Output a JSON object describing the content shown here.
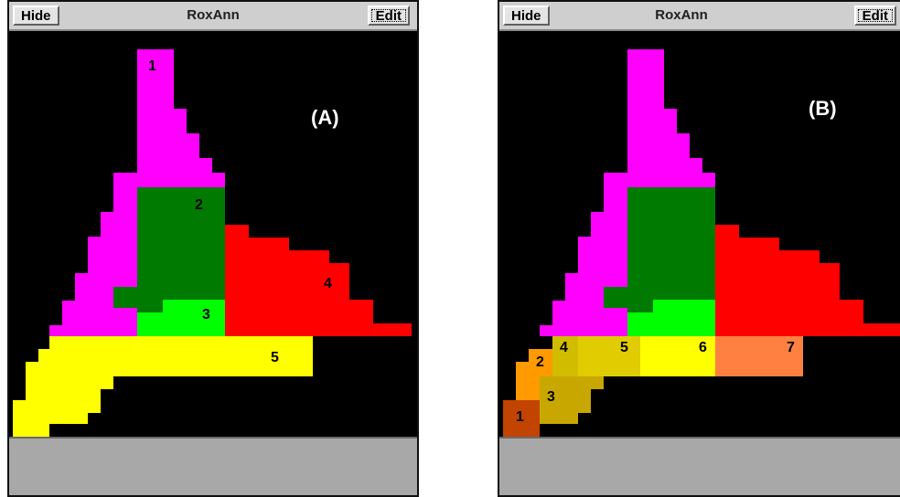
{
  "window_a": {
    "title": "RoxAnn",
    "hide_label": "Hide",
    "edit_label": "Edit",
    "panel_label": "(A)",
    "class_labels": [
      "1",
      "2",
      "3",
      "4",
      "5"
    ]
  },
  "window_b": {
    "title": "RoxAnn",
    "hide_label": "Hide",
    "edit_label": "Edit",
    "panel_label": "(B)",
    "class_labels": [
      "1",
      "2",
      "3",
      "4",
      "5",
      "6",
      "7"
    ]
  },
  "colors": {
    "background": "#000000",
    "magenta": "#ff00ff",
    "dark_green": "#007a00",
    "bright_green": "#00ff00",
    "red": "#ff0000",
    "yellow": "#ffff00",
    "dark_orange": "#c24400",
    "orange": "#ff9a00",
    "olive": "#c8a800",
    "mustard": "#e0cc00",
    "light_orange": "#ff8040",
    "status_gray": "#a8a8a8"
  }
}
